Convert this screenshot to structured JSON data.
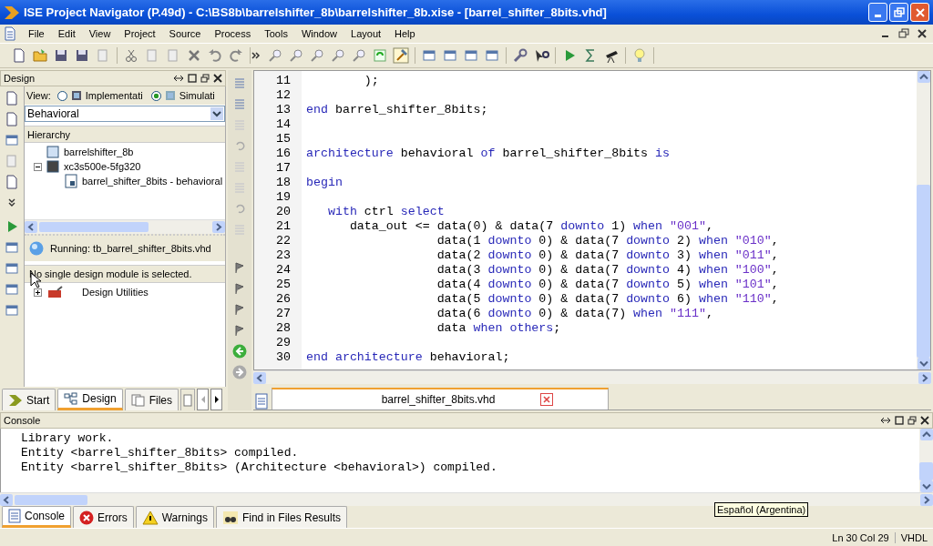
{
  "window": {
    "title": "ISE Project Navigator (P.49d) - C:\\BS8b\\barrelshifter_8b\\barrelshifter_8b.xise - [barrel_shifter_8bits.vhd]"
  },
  "menu": [
    "File",
    "Edit",
    "View",
    "Project",
    "Source",
    "Process",
    "Tools",
    "Window",
    "Layout",
    "Help"
  ],
  "design_panel": {
    "title": "Design",
    "view_label": "View:",
    "view_options": [
      {
        "label": "Implementati",
        "selected": false
      },
      {
        "label": "Simulati",
        "selected": true
      }
    ],
    "dropdown": {
      "value": "Behavioral"
    },
    "hierarchy_title": "Hierarchy",
    "hierarchy": [
      {
        "label": "barrelshifter_8b",
        "kind": "project"
      },
      {
        "label": "xc3s500e-5fg320",
        "kind": "chip",
        "expanded": true,
        "children": [
          {
            "label": "barrel_shifter_8bits - behavioral",
            "kind": "vhdl"
          }
        ]
      }
    ],
    "running": "Running: tb_barrel_shifter_8bits.vhd",
    "process_header": "No single design module is selected.",
    "processes": [
      {
        "label": "Design Utilities",
        "expanded": false
      }
    ],
    "tabs": [
      {
        "label": "Start",
        "selected": false,
        "kind": "start"
      },
      {
        "label": "Design",
        "selected": true,
        "kind": "design"
      },
      {
        "label": "Files",
        "selected": false,
        "kind": "files"
      }
    ]
  },
  "editor": {
    "lines": [
      {
        "number": "11",
        "tokens": [
          {
            "kind": "plain",
            "text": "        );"
          }
        ]
      },
      {
        "number": "12"
      },
      {
        "number": "13",
        "tokens": [
          {
            "kind": "keyword",
            "text": "end"
          },
          {
            "kind": "plain",
            "text": " barrel_shifter_8bits;"
          }
        ]
      },
      {
        "number": "14"
      },
      {
        "number": "15"
      },
      {
        "number": "16",
        "tokens": [
          {
            "kind": "keyword",
            "text": "architecture"
          },
          {
            "kind": "plain",
            "text": " behavioral "
          },
          {
            "kind": "keyword",
            "text": "of"
          },
          {
            "kind": "plain",
            "text": " barrel_shifter_8bits "
          },
          {
            "kind": "keyword",
            "text": "is"
          }
        ]
      },
      {
        "number": "17"
      },
      {
        "number": "18",
        "tokens": [
          {
            "kind": "keyword",
            "text": "begin"
          }
        ]
      },
      {
        "number": "19"
      },
      {
        "number": "20",
        "tokens": [
          {
            "kind": "keyword",
            "text": "   with"
          },
          {
            "kind": "plain",
            "text": " ctrl "
          },
          {
            "kind": "keyword",
            "text": "select"
          }
        ]
      },
      {
        "number": "21",
        "tokens": [
          {
            "kind": "plain",
            "text": "      data_out <= data(0) & data(7 "
          },
          {
            "kind": "keyword",
            "text": "downto"
          },
          {
            "kind": "plain",
            "text": " 1) "
          },
          {
            "kind": "keyword",
            "text": "when"
          },
          {
            "kind": "string",
            "text": " \"001\""
          },
          {
            "kind": "plain",
            "text": ","
          }
        ]
      },
      {
        "number": "22",
        "tokens": [
          {
            "kind": "plain",
            "text": "                  data(1 "
          },
          {
            "kind": "keyword",
            "text": "downto"
          },
          {
            "kind": "plain",
            "text": " 0) & data(7 "
          },
          {
            "kind": "keyword",
            "text": "downto"
          },
          {
            "kind": "plain",
            "text": " 2) "
          },
          {
            "kind": "keyword",
            "text": "when"
          },
          {
            "kind": "string",
            "text": " \"010\""
          },
          {
            "kind": "plain",
            "text": ","
          }
        ]
      },
      {
        "number": "23",
        "tokens": [
          {
            "kind": "plain",
            "text": "                  data(2 "
          },
          {
            "kind": "keyword",
            "text": "downto"
          },
          {
            "kind": "plain",
            "text": " 0) & data(7 "
          },
          {
            "kind": "keyword",
            "text": "downto"
          },
          {
            "kind": "plain",
            "text": " 3) "
          },
          {
            "kind": "keyword",
            "text": "when"
          },
          {
            "kind": "string",
            "text": " \"011\""
          },
          {
            "kind": "plain",
            "text": ","
          }
        ]
      },
      {
        "number": "24",
        "tokens": [
          {
            "kind": "plain",
            "text": "                  data(3 "
          },
          {
            "kind": "keyword",
            "text": "downto"
          },
          {
            "kind": "plain",
            "text": " 0) & data(7 "
          },
          {
            "kind": "keyword",
            "text": "downto"
          },
          {
            "kind": "plain",
            "text": " 4) "
          },
          {
            "kind": "keyword",
            "text": "when"
          },
          {
            "kind": "string",
            "text": " \"100\""
          },
          {
            "kind": "plain",
            "text": ","
          }
        ]
      },
      {
        "number": "25",
        "tokens": [
          {
            "kind": "plain",
            "text": "                  data(4 "
          },
          {
            "kind": "keyword",
            "text": "downto"
          },
          {
            "kind": "plain",
            "text": " 0) & data(7 "
          },
          {
            "kind": "keyword",
            "text": "downto"
          },
          {
            "kind": "plain",
            "text": " 5) "
          },
          {
            "kind": "keyword",
            "text": "when"
          },
          {
            "kind": "string",
            "text": " \"101\""
          },
          {
            "kind": "plain",
            "text": ","
          }
        ]
      },
      {
        "number": "26",
        "tokens": [
          {
            "kind": "plain",
            "text": "                  data(5 "
          },
          {
            "kind": "keyword",
            "text": "downto"
          },
          {
            "kind": "plain",
            "text": " 0) & data(7 "
          },
          {
            "kind": "keyword",
            "text": "downto"
          },
          {
            "kind": "plain",
            "text": " 6) "
          },
          {
            "kind": "keyword",
            "text": "when"
          },
          {
            "kind": "string",
            "text": " \"110\""
          },
          {
            "kind": "plain",
            "text": ","
          }
        ]
      },
      {
        "number": "27",
        "tokens": [
          {
            "kind": "plain",
            "text": "                  data(6 "
          },
          {
            "kind": "keyword",
            "text": "downto"
          },
          {
            "kind": "plain",
            "text": " 0) & data(7) "
          },
          {
            "kind": "keyword",
            "text": "when"
          },
          {
            "kind": "string",
            "text": " \"111\""
          },
          {
            "kind": "plain",
            "text": ","
          }
        ]
      },
      {
        "number": "28",
        "tokens": [
          {
            "kind": "plain",
            "text": "                  data "
          },
          {
            "kind": "keyword",
            "text": "when"
          },
          {
            "kind": "keyword",
            "text": " others"
          },
          {
            "kind": "plain",
            "text": ";"
          }
        ]
      },
      {
        "number": "29"
      },
      {
        "number": "30",
        "tokens": [
          {
            "kind": "keyword",
            "text": "end"
          },
          {
            "kind": "keyword",
            "text": " architecture"
          },
          {
            "kind": "plain",
            "text": " behavioral;"
          }
        ]
      }
    ],
    "tabs": [
      {
        "label": "barrel_shifter_8bits.vhd",
        "selected": true
      }
    ]
  },
  "console": {
    "title": "Console",
    "lines": [
      "Library work.",
      "Entity <barrel_shifter_8bits> compiled.",
      "Entity <barrel_shifter_8bits> (Architecture <behavioral>) compiled."
    ],
    "tabs": [
      {
        "label": "Console",
        "selected": true,
        "kind": "console"
      },
      {
        "label": "Errors",
        "selected": false,
        "kind": "errors"
      },
      {
        "label": "Warnings",
        "selected": false,
        "kind": "warnings"
      },
      {
        "label": "Find in Files Results",
        "selected": false,
        "kind": "find"
      }
    ]
  },
  "tooltip": "Español (Argentina)",
  "status_bar": {
    "position": "Ln 30 Col 29",
    "language": "VHDL"
  }
}
